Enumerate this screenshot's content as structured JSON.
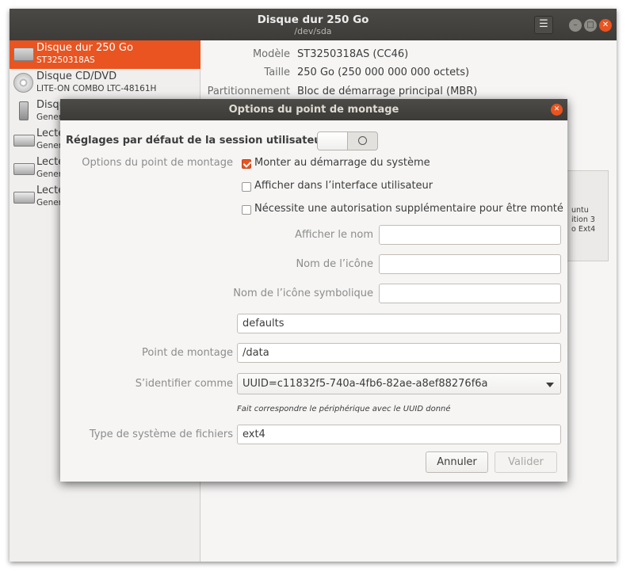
{
  "window": {
    "title": "Disque dur 250 Go",
    "subtitle": "/dev/sda",
    "menu_icon": "hamburger-menu-icon"
  },
  "sidebar": {
    "items": [
      {
        "name": "Disque dur 250 Go",
        "sub": "ST3250318AS",
        "icon": "hard-drive-icon",
        "selected": true
      },
      {
        "name": "Disque CD/DVD",
        "sub": "LITE-ON COMBO LTC-48161H",
        "icon": "optical-drive-icon",
        "selected": false
      },
      {
        "name": "Disqu",
        "sub": "Gener",
        "icon": "usb-drive-icon",
        "selected": false
      },
      {
        "name": "Lecte",
        "sub": "Gener",
        "icon": "card-reader-icon",
        "selected": false
      },
      {
        "name": "Lecte",
        "sub": "Gener",
        "icon": "card-reader-icon",
        "selected": false
      },
      {
        "name": "Lecte",
        "sub": "Gener",
        "icon": "card-reader-icon",
        "selected": false
      }
    ]
  },
  "details": {
    "model_label": "Modèle",
    "model_value": "ST3250318AS (CC46)",
    "size_label": "Taille",
    "size_value": "250 Go (250 000 000 000 octets)",
    "partition_label": "Partitionnement",
    "partition_value": "Bloc de démarrage principal (MBR)"
  },
  "volume_fragment": {
    "line1": "untu",
    "line2": "ition 3",
    "line3": "o Ext4"
  },
  "dialog": {
    "title": "Options du point de montage",
    "session_defaults_label": "Réglages par défaut de la session utilisateur",
    "session_defaults_on": false,
    "mount_options_label": "Options du point de montage",
    "checkboxes": [
      {
        "label": "Monter au démarrage du système",
        "checked": true
      },
      {
        "label": "Afficher dans l’interface utilisateur",
        "checked": false
      },
      {
        "label": "Nécessite une autorisation supplémentaire pour être monté",
        "checked": false
      }
    ],
    "display_name_label": "Afficher le nom",
    "display_name_value": "",
    "icon_name_label": "Nom de l’icône",
    "icon_name_value": "",
    "symbolic_icon_label": "Nom de l’icône symbolique",
    "symbolic_icon_value": "",
    "options_value": "defaults",
    "mount_point_label": "Point de montage",
    "mount_point_value": "/data",
    "identify_as_label": "S’identifier comme",
    "identify_as_value": "UUID=c11832f5-740a-4fb6-82ae-a8ef88276f6a",
    "identify_hint": "Fait correspondre le périphérique avec le UUID donné",
    "fs_type_label": "Type de système de fichiers",
    "fs_type_value": "ext4",
    "cancel_label": "Annuler",
    "ok_label": "Valider"
  },
  "colors": {
    "accent": "#e95420",
    "titlebar": "#3d3c39"
  }
}
